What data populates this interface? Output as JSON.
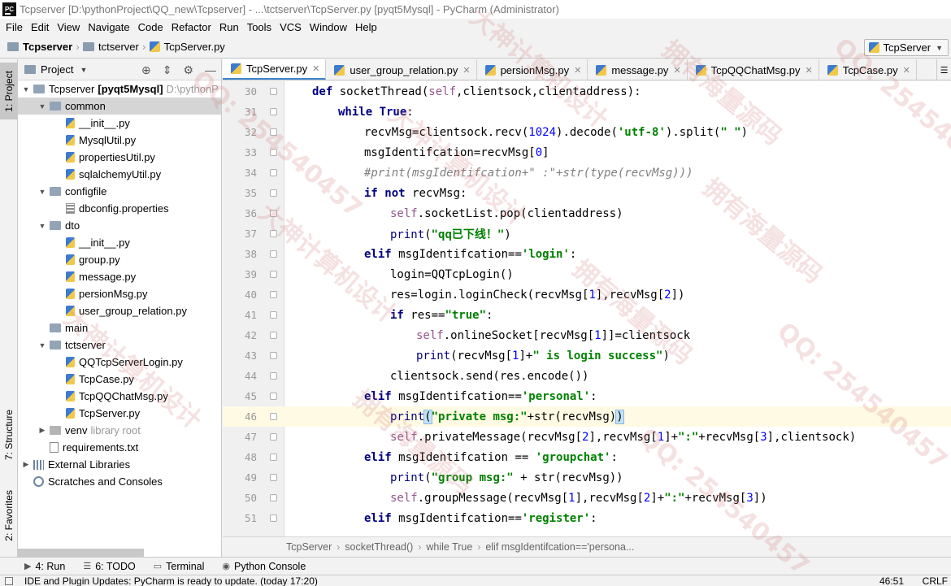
{
  "window": {
    "title": "Tcpserver [D:\\pythonProject\\QQ_new\\Tcpserver] - ...\\tctserver\\TcpServer.py [pyqt5Mysql] - PyCharm (Administrator)",
    "app_icon": "PC"
  },
  "menu": [
    "File",
    "Edit",
    "View",
    "Navigate",
    "Code",
    "Refactor",
    "Run",
    "Tools",
    "VCS",
    "Window",
    "Help"
  ],
  "nav": {
    "crumbs": [
      "Tcpserver",
      "tctserver",
      "TcpServer.py"
    ],
    "run_config": "TcpServer"
  },
  "left_strip": {
    "tabs": [
      "1: Project",
      "7: Structure",
      "2: Favorites"
    ]
  },
  "project_panel": {
    "title": "Project",
    "tree": [
      {
        "label": "Tcpserver",
        "bold_suffix": "[pyqt5Mysql]",
        "hint": "D:\\pythonP",
        "type": "folder",
        "level": 0,
        "arrow": "down"
      },
      {
        "label": "common",
        "type": "folder",
        "level": 1,
        "arrow": "down",
        "selected": true
      },
      {
        "label": "__init__.py",
        "type": "py",
        "level": 2
      },
      {
        "label": "MysqlUtil.py",
        "type": "py",
        "level": 2
      },
      {
        "label": "propertiesUtil.py",
        "type": "py",
        "level": 2
      },
      {
        "label": "sqlalchemyUtil.py",
        "type": "py",
        "level": 2
      },
      {
        "label": "configfile",
        "type": "folder",
        "level": 1,
        "arrow": "down"
      },
      {
        "label": "dbconfig.properties",
        "type": "prop",
        "level": 2
      },
      {
        "label": "dto",
        "type": "folder",
        "level": 1,
        "arrow": "down"
      },
      {
        "label": "__init__.py",
        "type": "py",
        "level": 2
      },
      {
        "label": "group.py",
        "type": "py",
        "level": 2
      },
      {
        "label": "message.py",
        "type": "py",
        "level": 2
      },
      {
        "label": "persionMsg.py",
        "type": "py",
        "level": 2
      },
      {
        "label": "user_group_relation.py",
        "type": "py",
        "level": 2
      },
      {
        "label": "main",
        "type": "folder",
        "level": 1
      },
      {
        "label": "tctserver",
        "type": "folder",
        "level": 1,
        "arrow": "down"
      },
      {
        "label": "QQTcpServerLogin.py",
        "type": "py",
        "level": 2
      },
      {
        "label": "TcpCase.py",
        "type": "py",
        "level": 2
      },
      {
        "label": "TcpQQChatMsg.py",
        "type": "py",
        "level": 2
      },
      {
        "label": "TcpServer.py",
        "type": "py",
        "level": 2
      },
      {
        "label": "venv",
        "hint": "library root",
        "type": "venv",
        "level": 1,
        "arrow": "right"
      },
      {
        "label": "requirements.txt",
        "type": "txt",
        "level": 1
      },
      {
        "label": "External Libraries",
        "type": "lib",
        "level": 0,
        "arrow": "right"
      },
      {
        "label": "Scratches and Consoles",
        "type": "scratch",
        "level": 0
      }
    ]
  },
  "editor_tabs": [
    {
      "label": "TcpServer.py",
      "active": true
    },
    {
      "label": "user_group_relation.py"
    },
    {
      "label": "persionMsg.py"
    },
    {
      "label": "message.py"
    },
    {
      "label": "TcpQQChatMsg.py"
    },
    {
      "label": "TcpCase.py"
    }
  ],
  "code": {
    "lines": [
      {
        "n": "30",
        "indent": 1,
        "tokens": [
          [
            "kw",
            "def "
          ],
          [
            "fn",
            "socketThread("
          ],
          [
            "self",
            "self"
          ],
          [
            "fn",
            ",clientsock,clientaddress):"
          ]
        ]
      },
      {
        "n": "31",
        "indent": 2,
        "tokens": [
          [
            "kw",
            "while True"
          ],
          [
            "fn",
            ":"
          ]
        ]
      },
      {
        "n": "32",
        "indent": 3,
        "tokens": [
          [
            "fn",
            "recvMsg=clientsock.recv("
          ],
          [
            "num",
            "1024"
          ],
          [
            "fn",
            ").decode("
          ],
          [
            "str",
            "'utf-8'"
          ],
          [
            "fn",
            ").split("
          ],
          [
            "str",
            "\" \""
          ],
          [
            "fn",
            ")"
          ]
        ]
      },
      {
        "n": "33",
        "indent": 3,
        "tokens": [
          [
            "fn",
            "msgIdentifcation=recvMsg["
          ],
          [
            "num",
            "0"
          ],
          [
            "fn",
            "]"
          ]
        ]
      },
      {
        "n": "34",
        "indent": 3,
        "tokens": [
          [
            "cmt",
            "#print(msgIdentifcation+\" :\"+str(type(recvMsg)))"
          ]
        ]
      },
      {
        "n": "35",
        "indent": 3,
        "tokens": [
          [
            "kw",
            "if not "
          ],
          [
            "fn",
            "recvMsg:"
          ]
        ]
      },
      {
        "n": "36",
        "indent": 4,
        "tokens": [
          [
            "self",
            "self"
          ],
          [
            "fn",
            ".socketList.pop(clientaddress)"
          ]
        ]
      },
      {
        "n": "37",
        "indent": 4,
        "tokens": [
          [
            "bi",
            "print"
          ],
          [
            "fn",
            "("
          ],
          [
            "str",
            "\"qq已下线！\""
          ],
          [
            "fn",
            ")"
          ]
        ]
      },
      {
        "n": "38",
        "indent": 3,
        "tokens": [
          [
            "kw",
            "elif "
          ],
          [
            "fn",
            "msgIdentifcation=="
          ],
          [
            "str",
            "'login'"
          ],
          [
            "fn",
            ":"
          ]
        ]
      },
      {
        "n": "39",
        "indent": 4,
        "tokens": [
          [
            "fn",
            "login=QQTcpLogin()"
          ]
        ]
      },
      {
        "n": "40",
        "indent": 4,
        "tokens": [
          [
            "fn",
            "res=login.loginCheck(recvMsg["
          ],
          [
            "num",
            "1"
          ],
          [
            "fn",
            "],recvMsg["
          ],
          [
            "num",
            "2"
          ],
          [
            "fn",
            "])"
          ]
        ]
      },
      {
        "n": "41",
        "indent": 4,
        "tokens": [
          [
            "kw",
            "if "
          ],
          [
            "fn",
            "res=="
          ],
          [
            "str",
            "\"true\""
          ],
          [
            "fn",
            ":"
          ]
        ]
      },
      {
        "n": "42",
        "indent": 5,
        "tokens": [
          [
            "self",
            "self"
          ],
          [
            "fn",
            ".onlineSocket[recvMsg["
          ],
          [
            "num",
            "1"
          ],
          [
            "fn",
            "]]=clientsock"
          ]
        ]
      },
      {
        "n": "43",
        "indent": 5,
        "tokens": [
          [
            "bi",
            "print"
          ],
          [
            "fn",
            "(recvMsg["
          ],
          [
            "num",
            "1"
          ],
          [
            "fn",
            "]+"
          ],
          [
            "str",
            "\" is login success\""
          ],
          [
            "fn",
            ")"
          ]
        ]
      },
      {
        "n": "44",
        "indent": 4,
        "tokens": [
          [
            "fn",
            "clientsock.send(res.encode())"
          ]
        ]
      },
      {
        "n": "45",
        "indent": 3,
        "tokens": [
          [
            "kw",
            "elif "
          ],
          [
            "fn",
            "msgIdentifcation=="
          ],
          [
            "str",
            "'personal'"
          ],
          [
            "fn",
            ":"
          ]
        ]
      },
      {
        "n": "46",
        "indent": 4,
        "current": true,
        "tokens": [
          [
            "bi",
            "print"
          ],
          [
            "brk",
            "("
          ],
          [
            "str",
            "\"private msg:\""
          ],
          [
            "fn",
            "+str(recvMsg)"
          ],
          [
            "brk",
            ")"
          ]
        ]
      },
      {
        "n": "47",
        "indent": 4,
        "tokens": [
          [
            "self",
            "self"
          ],
          [
            "fn",
            ".privateMessage(recvMsg["
          ],
          [
            "num",
            "2"
          ],
          [
            "fn",
            "],recvMsg["
          ],
          [
            "num",
            "1"
          ],
          [
            "fn",
            "]+"
          ],
          [
            "str",
            "\":\""
          ],
          [
            "fn",
            "+recvMsg["
          ],
          [
            "num",
            "3"
          ],
          [
            "fn",
            "],clientsock)"
          ]
        ]
      },
      {
        "n": "48",
        "indent": 3,
        "tokens": [
          [
            "kw",
            "elif "
          ],
          [
            "fn",
            "msgIdentifcation == "
          ],
          [
            "str",
            "'groupchat'"
          ],
          [
            "fn",
            ":"
          ]
        ]
      },
      {
        "n": "49",
        "indent": 4,
        "tokens": [
          [
            "bi",
            "print"
          ],
          [
            "fn",
            "("
          ],
          [
            "str",
            "\"group msg:\""
          ],
          [
            "fn",
            " + str(recvMsg))"
          ]
        ]
      },
      {
        "n": "50",
        "indent": 4,
        "tokens": [
          [
            "self",
            "self"
          ],
          [
            "fn",
            ".groupMessage(recvMsg["
          ],
          [
            "num",
            "1"
          ],
          [
            "fn",
            "],recvMsg["
          ],
          [
            "num",
            "2"
          ],
          [
            "fn",
            "]+"
          ],
          [
            "str",
            "\":\""
          ],
          [
            "fn",
            "+recvMsg["
          ],
          [
            "num",
            "3"
          ],
          [
            "fn",
            "])"
          ]
        ]
      },
      {
        "n": "51",
        "indent": 3,
        "tokens": [
          [
            "kw",
            "elif "
          ],
          [
            "fn",
            "msgIdentifcation=="
          ],
          [
            "str",
            "'register'"
          ],
          [
            "fn",
            ":"
          ]
        ]
      }
    ]
  },
  "code_breadcrumb": [
    "TcpServer",
    "socketThread()",
    "while True",
    "elif msgIdentifcation=='persona..."
  ],
  "bottom_tools": [
    {
      "label": "4: Run",
      "icon": "run-icon"
    },
    {
      "label": "6: TODO",
      "icon": "todo-icon"
    },
    {
      "label": "Terminal",
      "icon": "terminal-icon"
    },
    {
      "label": "Python Console",
      "icon": "python-console-icon"
    }
  ],
  "status": {
    "message": "IDE and Plugin Updates: PyCharm is ready to update. (today 17:20)",
    "position": "46:51",
    "line_ending": "CRLF"
  },
  "watermark": {
    "texts": [
      "大神计算机设计",
      "拥有海量源码",
      "QQ: 254540457",
      "大神计算机设计",
      "拥有海量源码",
      "QQ: 254540457",
      "大神计算机设计",
      "拥有海量源码",
      "QQ: 254540457",
      "大神计算机设计",
      "拥有海量源码",
      "QQ: 254540457"
    ]
  }
}
